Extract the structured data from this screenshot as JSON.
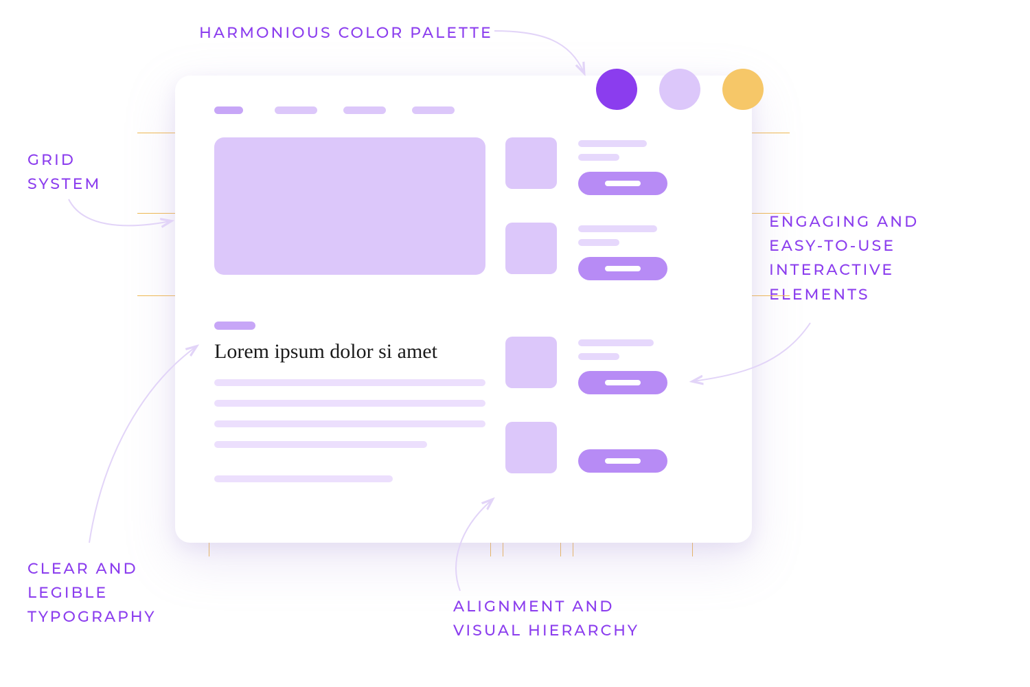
{
  "labels": {
    "palette": "HARMONIOUS COLOR PALETTE",
    "grid": "GRID\nSYSTEM",
    "interactive": "ENGAGING AND\nEASY-TO-USE\nINTERACTIVE\nELEMENTS",
    "typography": "CLEAR AND\nLEGIBLE\nTYPOGRAPHY",
    "alignment": "ALIGNMENT AND\nVISUAL HIERARCHY"
  },
  "mockup": {
    "heading": "Lorem ipsum dolor si amet"
  },
  "palette": {
    "swatch1": "#8b3dee",
    "swatch2": "#dcc7fa",
    "swatch3": "#f6c768"
  },
  "colors": {
    "accent": "#8b3dee",
    "light": "#dcc7fa",
    "button": "#b78bf5",
    "grid": "#f0b94f"
  }
}
